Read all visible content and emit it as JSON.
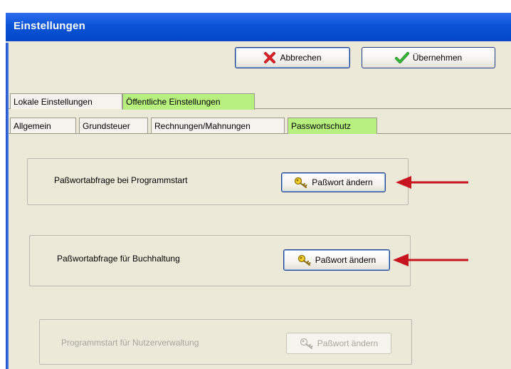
{
  "window": {
    "title": "Einstellungen"
  },
  "toolbar": {
    "cancel_label": "Abbrechen",
    "apply_label": "Übernehmen"
  },
  "main_tabs": [
    {
      "label": "Lokale Einstellungen",
      "active": false
    },
    {
      "label": "Öffentliche Einstellungen",
      "active": true
    }
  ],
  "sub_tabs": [
    {
      "label": "Allgemein",
      "active": false
    },
    {
      "label": "Grundsteuer",
      "active": false
    },
    {
      "label": "Rechnungen/Mahnungen",
      "active": false
    },
    {
      "label": "Passwortschutz",
      "active": true
    }
  ],
  "password_groups": [
    {
      "label": "Paßwortabfrage bei Programmstart",
      "button": "Paßwort ändern",
      "enabled": true,
      "annotated": true
    },
    {
      "label": "Paßwortabfrage für Buchhaltung",
      "button": "Paßwort ändern",
      "enabled": true,
      "annotated": true
    },
    {
      "label": "Programmstart für Nutzerverwaltung",
      "button": "Paßwort ändern",
      "enabled": false,
      "annotated": false
    }
  ],
  "colors": {
    "titlebar": "#0a53d6",
    "active_tab": "#b7f07e",
    "window_bg": "#ece9d8",
    "annotation_arrow": "#c8141e",
    "key_icon": "#e8c21a"
  },
  "icons": {
    "cancel": "red-x-icon",
    "apply": "green-check-icon",
    "password": "key-icon",
    "annotation": "red-arrow-icon"
  }
}
